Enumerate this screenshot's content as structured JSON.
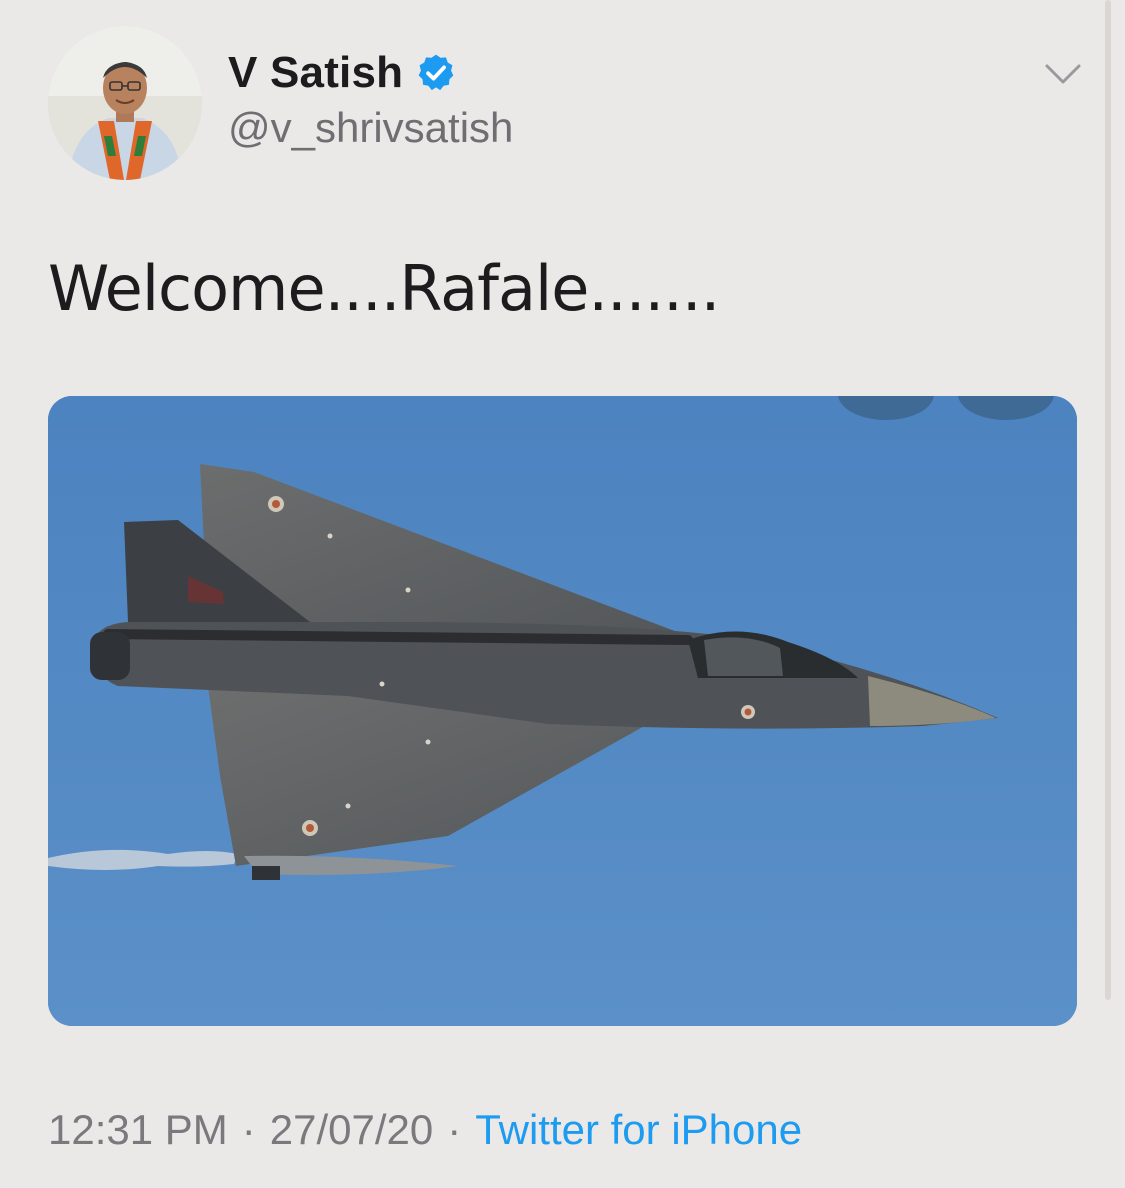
{
  "tweet": {
    "author_name": "V Satish",
    "author_handle": "@v_shrivsatish",
    "verified": true,
    "text": "Welcome....Rafale.......",
    "time": "12:31 PM",
    "date": "27/07/20",
    "separator": "·",
    "source": "Twitter for iPhone",
    "media_description": "fighter-jet-photo"
  },
  "icons": {
    "verified": "verified-badge-icon",
    "more": "chevron-down-icon"
  },
  "colors": {
    "background": "#ebe9e7",
    "link": "#1d9bf0",
    "verified": "#1d9bf0",
    "sky": "#4f86c1"
  }
}
